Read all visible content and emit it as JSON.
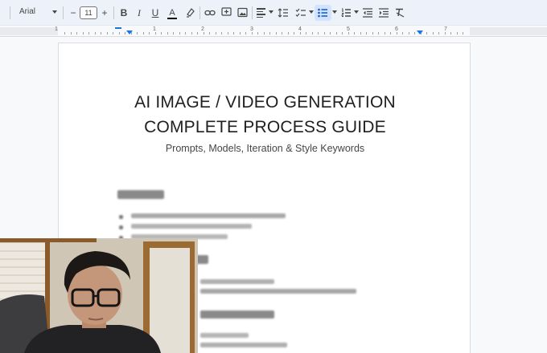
{
  "toolbar": {
    "font_family": "Arial",
    "font_size": "11",
    "decrease_size": "−",
    "increase_size": "+",
    "bold": "B",
    "italic": "I",
    "underline": "U",
    "text_color": "A",
    "active_tool": "bulleted-list"
  },
  "ruler": {
    "numbers": [
      "1",
      "1",
      "2",
      "3",
      "4",
      "5",
      "6",
      "7"
    ]
  },
  "document": {
    "title_line1": "AI IMAGE / VIDEO GENERATION",
    "title_line2": "COMPLETE PROCESS GUIDE",
    "subtitle": "Prompts, Models, Iteration & Style Keywords"
  },
  "colors": {
    "accent": "#1a73e8",
    "toolbar_bg": "#edf2fa",
    "active_bg": "#d3e3fd"
  }
}
